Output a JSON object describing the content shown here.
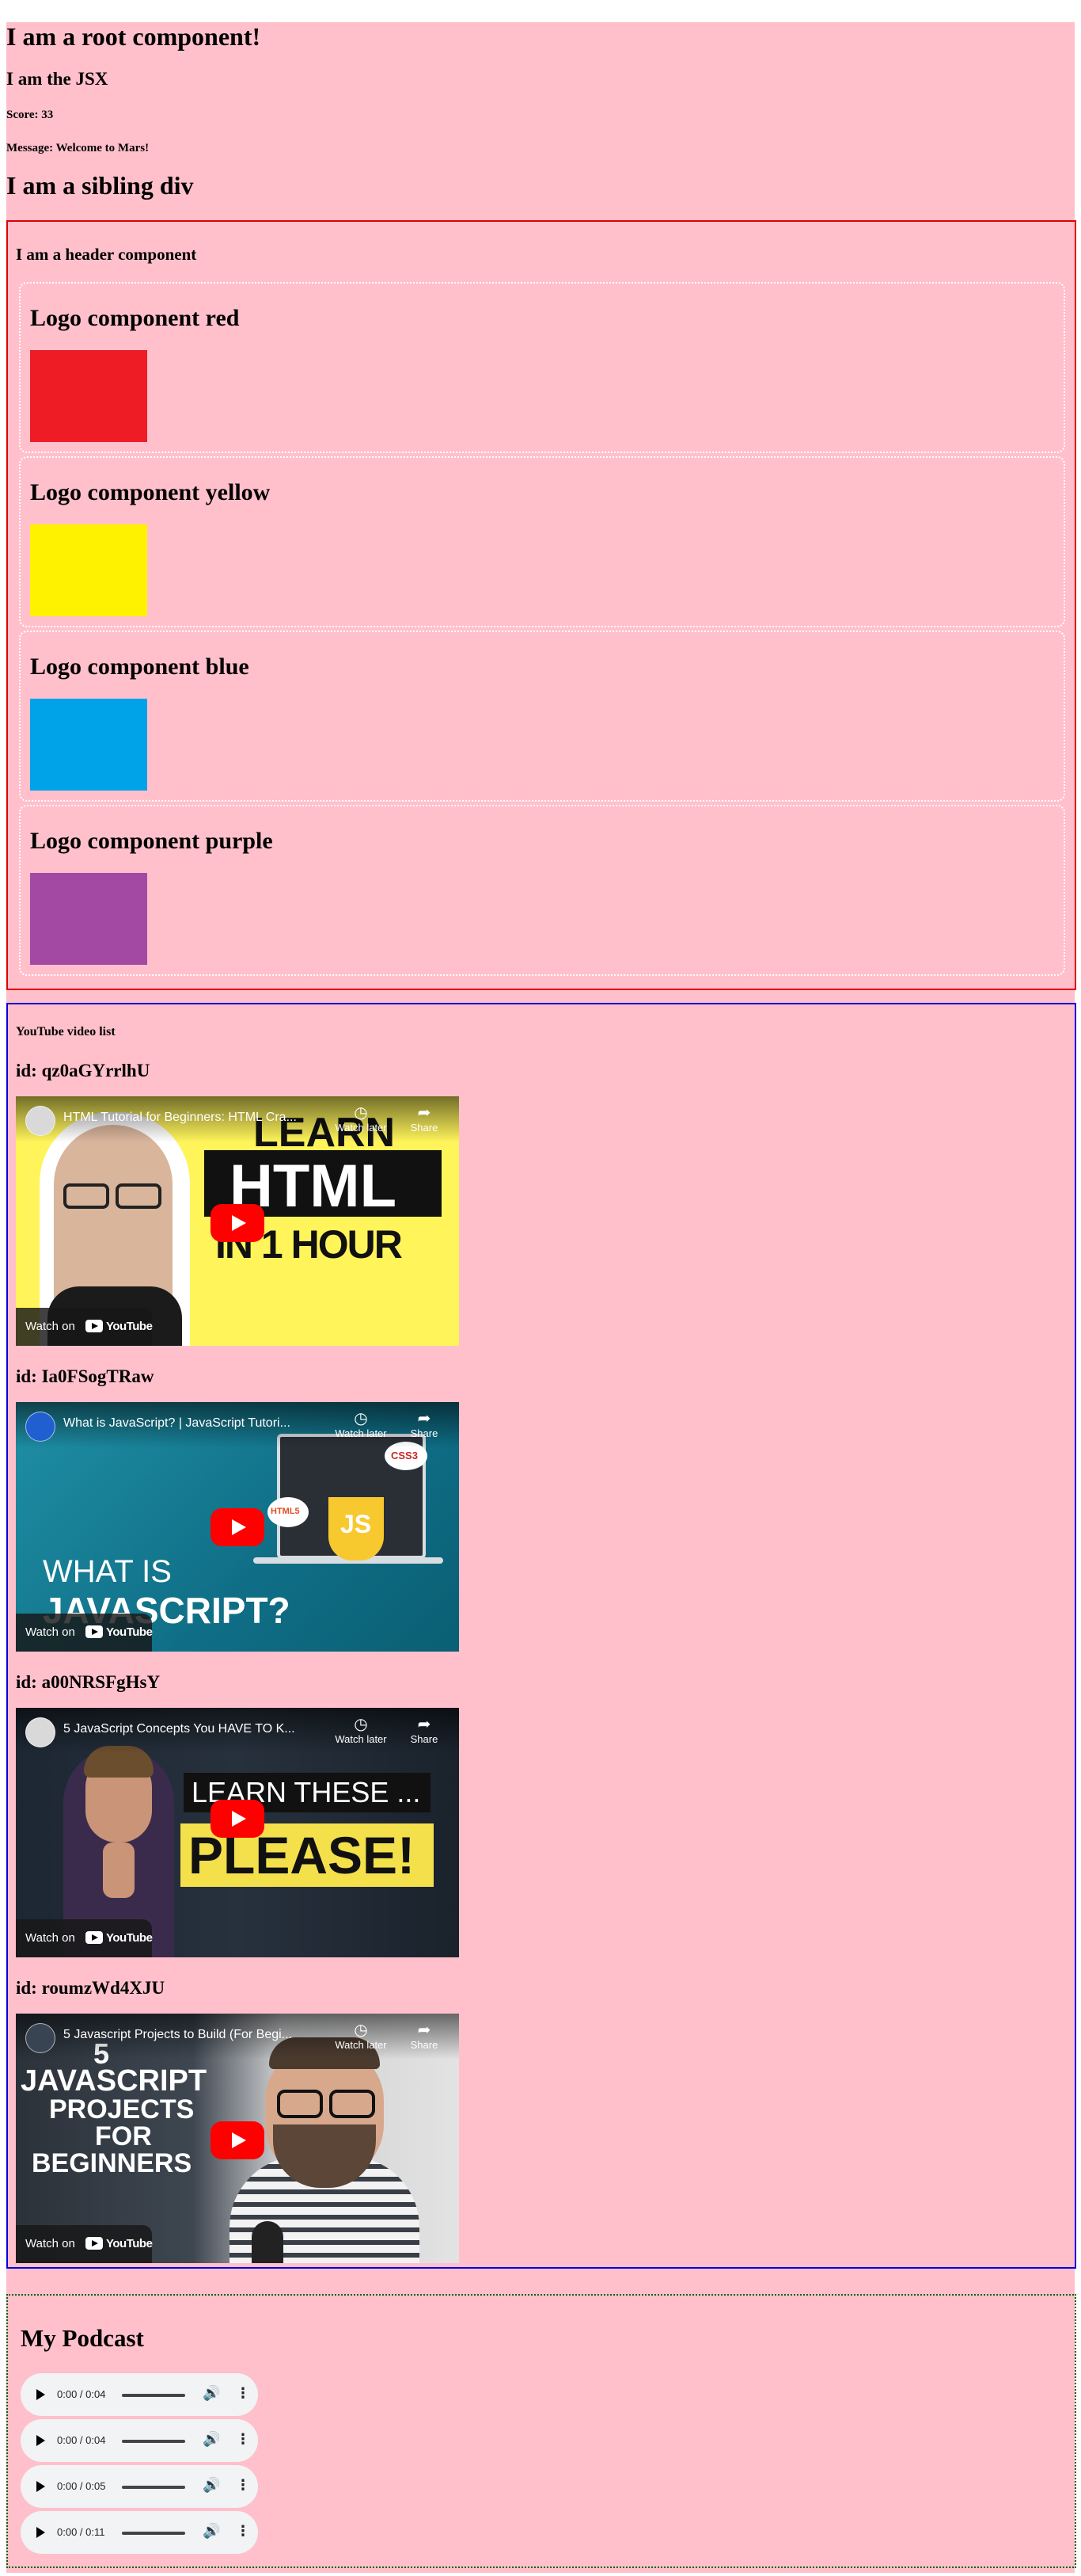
{
  "root": {
    "heading": "I am a root component!",
    "jsx": "I am the JSX",
    "score": "Score: 33",
    "message": "Message: Welcome to Mars!",
    "sibling": "I am a sibling div"
  },
  "header": {
    "title": "I am a header component",
    "logos": [
      {
        "label": "Logo component red",
        "color": "#ee1c25"
      },
      {
        "label": "Logo component yellow",
        "color": "#fff200"
      },
      {
        "label": "Logo component blue",
        "color": "#00a2e8"
      },
      {
        "label": "Logo component purple",
        "color": "#a349a4"
      }
    ]
  },
  "youtube": {
    "title": "YouTube video list",
    "videos": [
      {
        "id": "id: qz0aGYrrlhU",
        "title": "HTML Tutorial for Beginners: HTML Cra...",
        "watch_later": "Watch later",
        "share": "Share",
        "watch_on": "Watch on",
        "brand": "YouTube",
        "thumb_text": [
          "LEARN",
          "HTML",
          "IN 1 HOUR"
        ]
      },
      {
        "id": "id: Ia0FSogTRaw",
        "title": "What is JavaScript? | JavaScript Tutori...",
        "watch_later": "Watch later",
        "share": "Share",
        "watch_on": "Watch on",
        "brand": "YouTube",
        "thumb_text": [
          "WHAT IS",
          "JAVASCRIPT?",
          "JS",
          "CSS3",
          "HTML5"
        ]
      },
      {
        "id": "id: a00NRSFgHsY",
        "title": "5 JavaScript Concepts You HAVE TO K...",
        "watch_later": "Watch later",
        "share": "Share",
        "watch_on": "Watch on",
        "brand": "YouTube",
        "thumb_text": [
          "LEARN THESE ...",
          "PLEASE!"
        ]
      },
      {
        "id": "id: roumzWd4XJU",
        "title": "5 Javascript Projects to Build (For Begi...",
        "watch_later": "Watch later",
        "share": "Share",
        "watch_on": "Watch on",
        "brand": "YouTube",
        "thumb_text": [
          "5",
          "JAVASCRIPT",
          "PROJECTS",
          "FOR",
          "BEGINNERS"
        ]
      }
    ]
  },
  "podcast": {
    "title": "My Podcast",
    "episodes": [
      {
        "time": "0:00 / 0:04"
      },
      {
        "time": "0:00 / 0:04"
      },
      {
        "time": "0:00 / 0:05"
      },
      {
        "time": "0:00 / 0:11"
      }
    ]
  }
}
